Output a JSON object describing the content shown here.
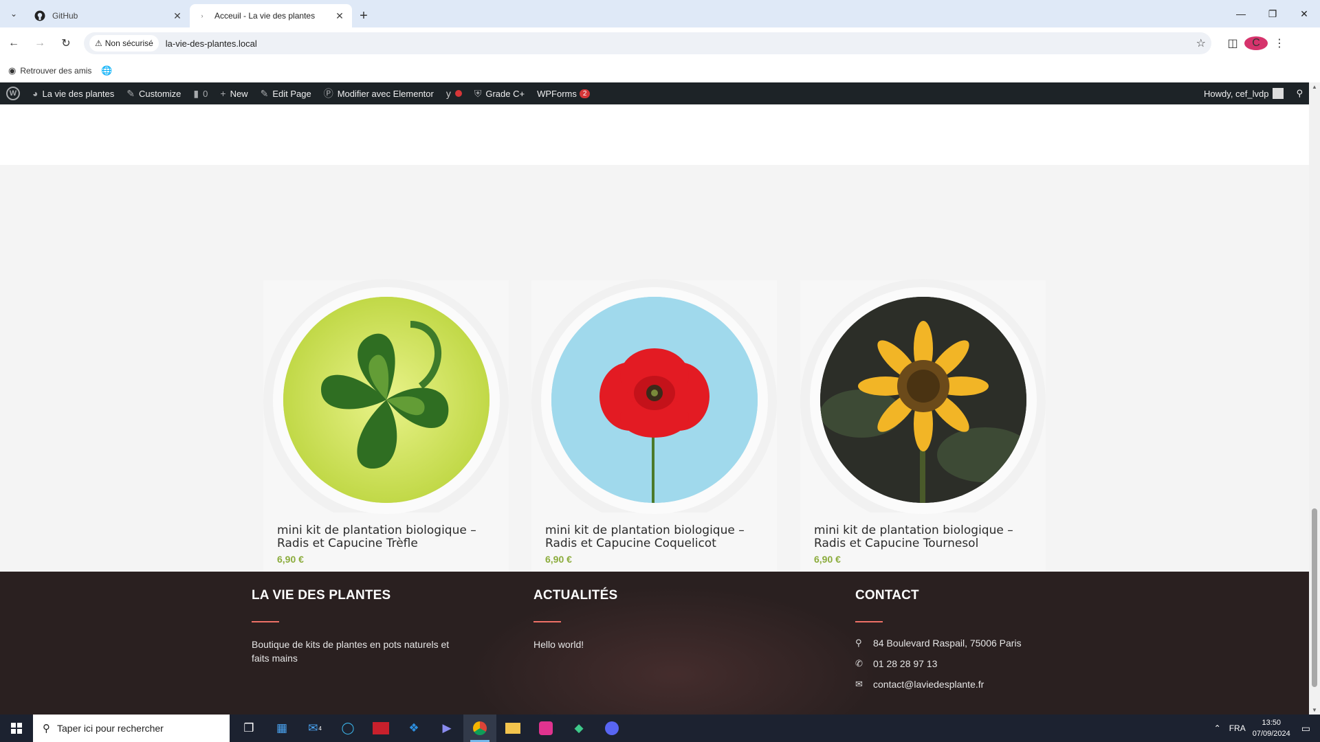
{
  "browser": {
    "tabs": [
      {
        "title": "GitHub",
        "active": false
      },
      {
        "title": "Acceuil - La vie des plantes",
        "active": true
      }
    ],
    "security_label": "Non sécurisé",
    "url": "la-vie-des-plantes.local",
    "profile_initial": "C",
    "bookmarks": [
      {
        "label": "Retrouver des amis"
      }
    ]
  },
  "admin_bar": {
    "site_name": "La vie des plantes",
    "customize": "Customize",
    "comments_count": "0",
    "new": "New",
    "edit_page": "Edit Page",
    "elementor": "Modifier avec Elementor",
    "grade": "Grade C+",
    "wpforms": "WPForms",
    "wpforms_count": "2",
    "howdy": "Howdy, cef_lvdp"
  },
  "products": [
    {
      "name": "mini kit de plantation biologique – Radis et Capucine Trèfle",
      "price": "6,90 €",
      "image": "clover",
      "image_bg": "#cfe462"
    },
    {
      "name": "mini kit de plantation biologique – Radis et Capucine Coquelicot",
      "price": "6,90 €",
      "image": "poppy",
      "image_bg": "#a0d9ec"
    },
    {
      "name": "mini kit de plantation biologique – Radis et Capucine Tournesol",
      "price": "6,90 €",
      "image": "sunflower",
      "image_bg": "#2a2a26"
    }
  ],
  "footer": {
    "about": {
      "title": "LA VIE DES PLANTES",
      "text": "Boutique de kits de plantes en pots naturels et faits mains"
    },
    "news": {
      "title": "ACTUALITÉS",
      "post": "Hello world!"
    },
    "contact": {
      "title": "CONTACT",
      "address": "84 Boulevard Raspail, 75006 Paris",
      "phone": "01 28 28 97 13",
      "email": "contact@laviedesplante.fr"
    }
  },
  "taskbar": {
    "search_placeholder": "Taper ici pour rechercher",
    "language": "FRA",
    "time": "13:50",
    "date": "07/09/2024",
    "mail_badge": "4"
  },
  "colors": {
    "accent": "#f07167",
    "cart_bar": "#1f4b3b",
    "price": "#8bac3c",
    "footer_bg": "#2a2020"
  }
}
